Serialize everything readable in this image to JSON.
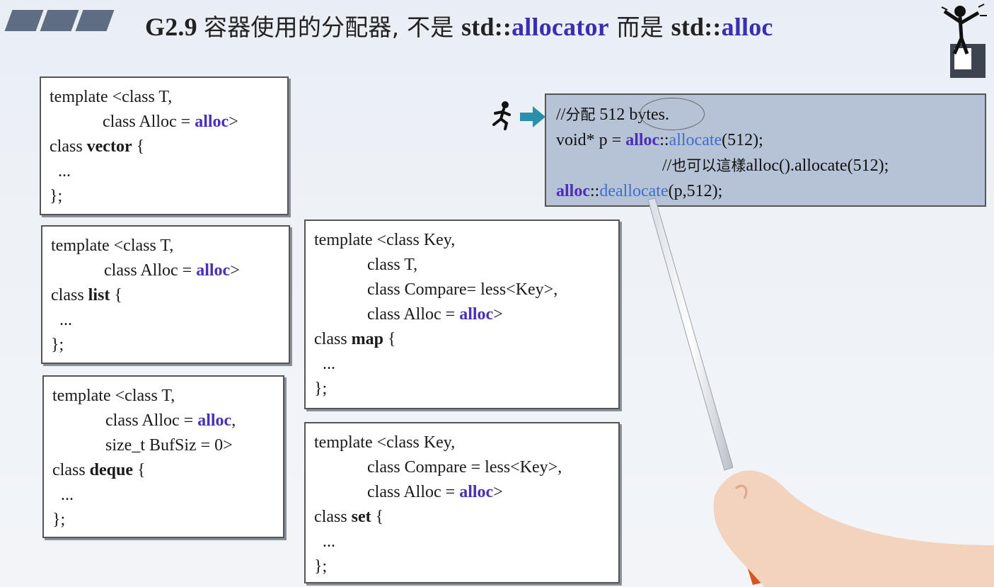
{
  "title": {
    "prefix": "G2.9 ",
    "cjk1": "容器使用的分配器, 不是 ",
    "std1": "std::",
    "alloc1": "allocator",
    "cjk2": " 而是 ",
    "std2": "std::",
    "alloc2": "alloc"
  },
  "boxes": {
    "vector": {
      "line1": "template <class T,",
      "line2a": "class Alloc = ",
      "line2b": "alloc",
      "line2c": ">",
      "line3a": "class ",
      "line3b": "vector",
      "line3c": " {",
      "line4": "  ...",
      "line5": "};"
    },
    "list": {
      "line1": "template <class T,",
      "line2a": "class Alloc = ",
      "line2b": "alloc",
      "line2c": ">",
      "line3a": "class ",
      "line3b": "list",
      "line3c": " {",
      "line4": "  ...",
      "line5": "};"
    },
    "deque": {
      "line1": "template <class T,",
      "line2a": "class Alloc = ",
      "line2b": "alloc",
      "line2c": ",",
      "line3": "size_t BufSiz = 0>",
      "line4a": "class ",
      "line4b": "deque",
      "line4c": " {",
      "line5": "  ...",
      "line6": "};"
    },
    "map": {
      "line1": "template <class Key,",
      "line2": "class T,",
      "line3": "class Compare= less<Key>,",
      "line4a": "class Alloc = ",
      "line4b": "alloc",
      "line4c": ">",
      "line5a": "class ",
      "line5b": "map",
      "line5c": " {",
      "line6": "  ...",
      "line7": "};"
    },
    "set": {
      "line1": "template <class Key,",
      "line2": "class Compare = less<Key>,",
      "line3a": "class Alloc = ",
      "line3b": "alloc",
      "line3c": ">",
      "line4a": "class ",
      "line4b": "set",
      "line4c": " {",
      "line5": "  ...",
      "line6": "};"
    }
  },
  "note": {
    "l1a": "//",
    "l1b": "分配",
    "l1c": " 512 bytes.",
    "l2a": "void* p = ",
    "l2b": "alloc",
    "l2c": "::",
    "l2d": "allocate",
    "l2e": "(512);",
    "l3a": "//",
    "l3b": "也可以這樣",
    "l3c": "alloc().allocate(512);",
    "l4a": "alloc",
    "l4b": "::",
    "l4c": "deallocate",
    "l4d": "(p,512);"
  },
  "colors": {
    "alloc": "#4b2fb8",
    "function": "#3f6fc9",
    "note_bg": "#b6c2d6",
    "arrow": "#2a8fa8"
  },
  "icons": [
    "runner-icon",
    "arrow-right-icon",
    "mascot-icon"
  ]
}
